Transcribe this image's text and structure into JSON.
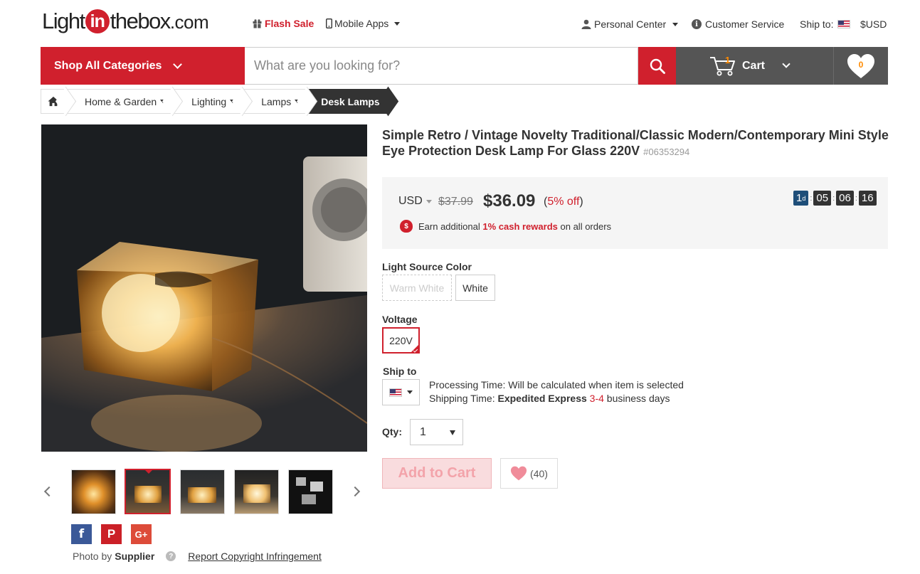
{
  "header": {
    "logo": {
      "pre": "Light",
      "mid": "in",
      "post": "thebox",
      "tld": ".com"
    },
    "flash_sale": "Flash Sale",
    "mobile_apps": "Mobile Apps",
    "personal_center": "Personal Center",
    "customer_service": "Customer Service",
    "ship_to_label": "Ship to:",
    "currency": "$USD"
  },
  "nav": {
    "shop_all": "Shop All Categories",
    "search_placeholder": "What are you looking for?",
    "cart_label": "Cart",
    "cart_count": "1",
    "wishlist_count": "0"
  },
  "breadcrumb": {
    "items": [
      "Home & Garden",
      "Lighting",
      "Lamps"
    ],
    "active": "Desk Lamps"
  },
  "product": {
    "title": "Simple Retro / Vintage Novelty Traditional/Classic Modern/Contemporary Mini Style Eye Protection Desk Lamp For Glass 220V",
    "sku": "#06353294",
    "currency_select": "USD",
    "old_price": "$37.99",
    "price": "$36.09",
    "discount_open": "(",
    "discount_value": "5% off",
    "discount_close": ")",
    "timer": {
      "days": "1",
      "day_unit": "d",
      "hours": "05",
      "minutes": "06",
      "seconds": "16"
    },
    "earn": {
      "pre": "Earn additional",
      "highlight": "1% cash rewards",
      "post": "on all orders"
    },
    "light_color_label": "Light Source Color",
    "light_colors": [
      "Warm White",
      "White"
    ],
    "voltage_label": "Voltage",
    "voltage": "220V",
    "ship_to_label": "Ship to",
    "processing_time": "Processing Time: Will be calculated when item is selected",
    "shipping_pre": "Shipping Time:",
    "shipping_method": "Expedited Express",
    "shipping_days": "3-4",
    "shipping_post": "business days",
    "qty_label": "Qty:",
    "qty_value": "1",
    "add_to_cart": "Add to Cart",
    "fav_count": "(40)"
  },
  "gallery": {
    "photo_by_label": "Photo by",
    "photo_by_value": "Supplier",
    "report": "Report Copyright Infringement",
    "social": {
      "facebook": "f",
      "pinterest": "P",
      "google_plus": "G+"
    }
  },
  "colors": {
    "brand_red": "#d0202d",
    "dark_grey": "#555555",
    "accent_orange": "#ff8a00"
  }
}
